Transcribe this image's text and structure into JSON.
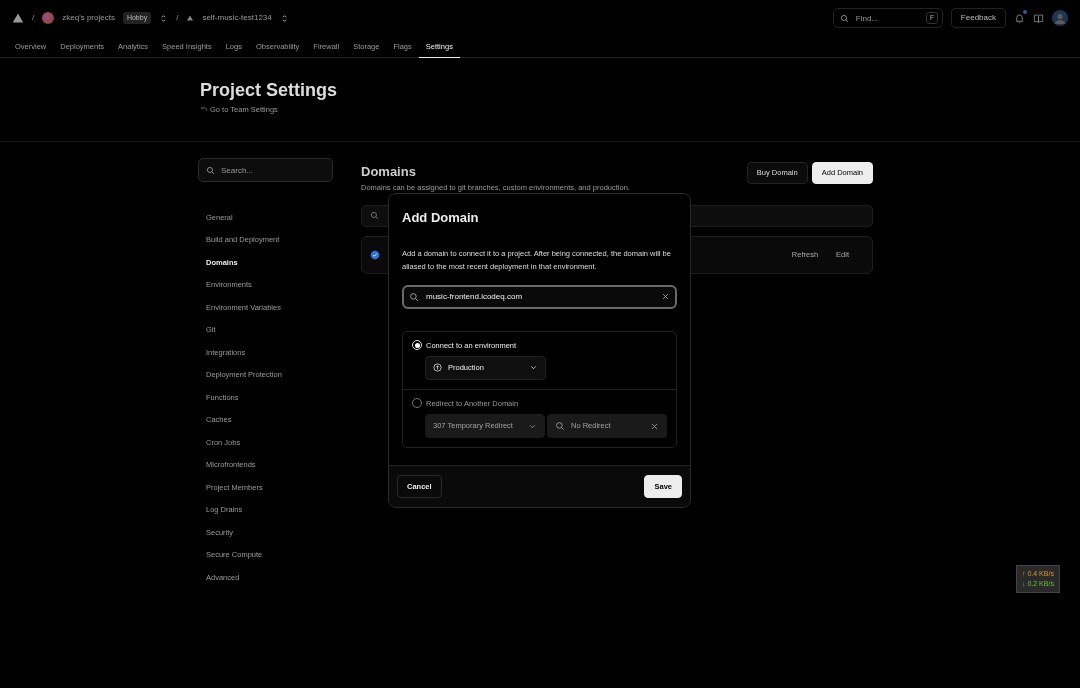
{
  "topbar": {
    "separators": [
      "/",
      "/"
    ],
    "team": {
      "name": "zkeq's projects",
      "plan": "Hobby"
    },
    "project": "self-music-test1234",
    "search": {
      "placeholder": "Find...",
      "shortcut": "F"
    },
    "feedback": "Feedback",
    "notification_unread": true
  },
  "tabs": [
    {
      "label": "Overview",
      "selected": false
    },
    {
      "label": "Deployments",
      "selected": false
    },
    {
      "label": "Analytics",
      "selected": false
    },
    {
      "label": "Speed Insights",
      "selected": false
    },
    {
      "label": "Logs",
      "selected": false
    },
    {
      "label": "Observability",
      "selected": false
    },
    {
      "label": "Firewall",
      "selected": false
    },
    {
      "label": "Storage",
      "selected": false
    },
    {
      "label": "Flags",
      "selected": false
    },
    {
      "label": "Settings",
      "selected": true
    }
  ],
  "page": {
    "title": "Project Settings",
    "back_link": "Go to Team Settings"
  },
  "sidebar": {
    "search": {
      "placeholder": "Search..."
    },
    "items": [
      {
        "label": "General",
        "selected": false
      },
      {
        "label": "Build and Deployment",
        "selected": false
      },
      {
        "label": "Domains",
        "selected": true
      },
      {
        "label": "Environments",
        "selected": false
      },
      {
        "label": "Environment Variables",
        "selected": false
      },
      {
        "label": "Git",
        "selected": false
      },
      {
        "label": "Integrations",
        "selected": false
      },
      {
        "label": "Deployment Protection",
        "selected": false
      },
      {
        "label": "Functions",
        "selected": false
      },
      {
        "label": "Caches",
        "selected": false
      },
      {
        "label": "Cron Jobs",
        "selected": false
      },
      {
        "label": "Microfrontends",
        "selected": false
      },
      {
        "label": "Project Members",
        "selected": false
      },
      {
        "label": "Log Drains",
        "selected": false
      },
      {
        "label": "Security",
        "selected": false
      },
      {
        "label": "Secure Compute",
        "selected": false
      },
      {
        "label": "Advanced",
        "selected": false
      }
    ]
  },
  "domains": {
    "title": "Domains",
    "description": "Domains can be assigned to git branches, custom environments, and production.",
    "buttons": [
      {
        "label": "Buy Domain",
        "kind": "secondary"
      },
      {
        "label": "Add Domain",
        "kind": "primary"
      }
    ],
    "row_actions": [
      "Refresh",
      "Edit"
    ]
  },
  "modal": {
    "title": "Add Domain",
    "description": "Add a domain to connect it to a project. After being connected, the domain will be aliased to the most recent deployment in that environment.",
    "domain_input": {
      "value": "music-frontend.icodeq.com"
    },
    "options": [
      {
        "label": "Connect to an environment",
        "selected": true,
        "controls": [
          {
            "kind": "environment-select",
            "value": "Production"
          }
        ]
      },
      {
        "label": "Redirect to Another Domain",
        "selected": false,
        "controls": [
          {
            "kind": "select",
            "value": "307 Temporary Redirect"
          },
          {
            "kind": "search",
            "value": "No Redirect"
          }
        ]
      }
    ],
    "cancel": "Cancel",
    "save": "Save"
  },
  "net_speed": [
    {
      "kind": "up",
      "text": "↑ 0.4 KB/s"
    },
    {
      "kind": "down",
      "text": "↓ 0.2 KB/s"
    }
  ]
}
